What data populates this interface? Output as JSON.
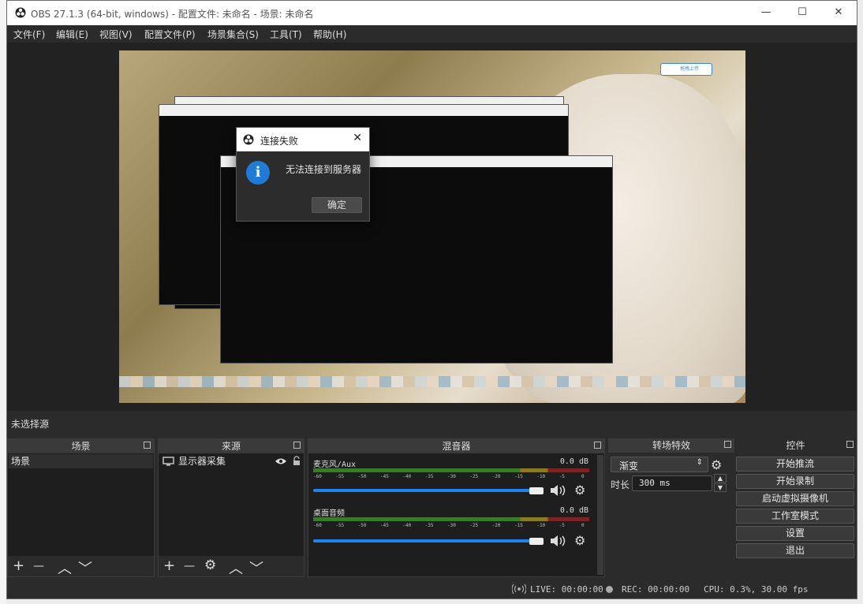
{
  "window": {
    "title": "OBS 27.1.3 (64-bit, windows) - 配置文件: 未命名 - 场景: 未命名",
    "minimize": "—",
    "maximize": "☐",
    "close": "✕"
  },
  "menu": [
    "文件(F)",
    "编辑(E)",
    "视图(V)",
    "配置文件(P)",
    "场景集合(S)",
    "工具(T)",
    "帮助(H)"
  ],
  "preview_badge": "拖拽上传",
  "dialog": {
    "title": "连接失败",
    "message": "无法连接到服务器",
    "ok": "确定",
    "close": "✕",
    "info_glyph": "i"
  },
  "source_bar": "未选择源",
  "docks": {
    "scenes": {
      "title": "场景",
      "items": [
        "场景"
      ]
    },
    "sources": {
      "title": "来源",
      "items": [
        {
          "label": "显示器采集",
          "visible": true,
          "locked": false
        }
      ]
    },
    "mixer": {
      "title": "混音器",
      "tracks": [
        {
          "name": "麦克风/Aux",
          "db": "0.0 dB",
          "volume": 0.95
        },
        {
          "name": "桌面音频",
          "db": "0.0 dB",
          "volume": 0.95
        }
      ],
      "ticks": [
        "-60",
        "-55",
        "-50",
        "-45",
        "-40",
        "-35",
        "-30",
        "-25",
        "-20",
        "-15",
        "-10",
        "-5",
        "0"
      ]
    },
    "transitions": {
      "title": "转场特效",
      "selected": "渐变",
      "duration_label": "时长",
      "duration": "300 ms"
    },
    "controls": {
      "title": "控件",
      "buttons": [
        "开始推流",
        "开始录制",
        "启动虚拟摄像机",
        "工作室模式",
        "设置",
        "退出"
      ]
    }
  },
  "tools": {
    "add": "+",
    "remove": "—",
    "up": "︿",
    "down": "﹀",
    "gear": "⚙"
  },
  "status": {
    "live": "LIVE: 00:00:00",
    "rec": "REC: 00:00:00",
    "cpu": "CPU: 0.3%, 30.00 fps"
  }
}
